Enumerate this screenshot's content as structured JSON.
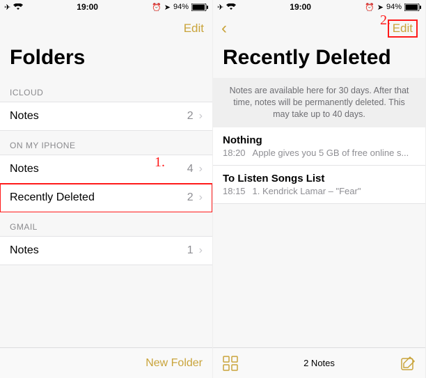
{
  "status": {
    "time": "19:00",
    "battery_pct": "94%"
  },
  "left_screen": {
    "nav_edit": "Edit",
    "title": "Folders",
    "sections": {
      "icloud": {
        "header": "ICLOUD",
        "notes_label": "Notes",
        "notes_count": "2"
      },
      "iphone": {
        "header": "ON MY IPHONE",
        "notes_label": "Notes",
        "notes_count": "4",
        "deleted_label": "Recently Deleted",
        "deleted_count": "2"
      },
      "gmail": {
        "header": "GMAIL",
        "notes_label": "Notes",
        "notes_count": "1"
      }
    },
    "toolbar": {
      "new_folder": "New Folder"
    },
    "annotation": "1."
  },
  "right_screen": {
    "nav_edit": "Edit",
    "title": "Recently Deleted",
    "banner": "Notes are available here for 30 days. After that time, notes will be permanently deleted. This may take up to 40 days.",
    "notes": [
      {
        "title": "Nothing",
        "time": "18:20",
        "preview": "Apple gives you 5 GB of free online s..."
      },
      {
        "title": "To Listen Songs List",
        "time": "18:15",
        "preview": "1. Kendrick Lamar – \"Fear\""
      }
    ],
    "toolbar": {
      "count": "2 Notes"
    },
    "annotation": "2."
  }
}
